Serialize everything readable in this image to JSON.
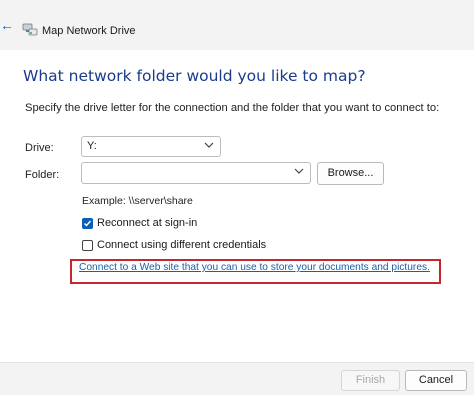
{
  "window": {
    "title": "Map Network Drive",
    "icons": {
      "back": "back-arrow-icon",
      "app": "network-drive-icon"
    }
  },
  "main": {
    "heading": "What network folder would you like to map?",
    "instruction": "Specify the drive letter for the connection and the folder that you want to connect to:",
    "drive": {
      "label": "Drive:",
      "value": "Y:"
    },
    "folder": {
      "label": "Folder:",
      "value": ""
    },
    "browse_label": "Browse...",
    "example": "Example: \\\\server\\share",
    "reconnect": {
      "label": "Reconnect at sign-in",
      "checked": true
    },
    "different_credentials": {
      "label": "Connect using different credentials",
      "checked": false
    },
    "web_link": "Connect to a Web site that you can use to store your documents and pictures.",
    "highlight_color": "#c9252c"
  },
  "footer": {
    "finish_label": "Finish",
    "finish_enabled": false,
    "cancel_label": "Cancel"
  },
  "colors": {
    "accent": "#0a5fb4",
    "heading": "#1a3c8a",
    "link": "#1b5fa8",
    "background_strip": "#0d5fb1"
  }
}
